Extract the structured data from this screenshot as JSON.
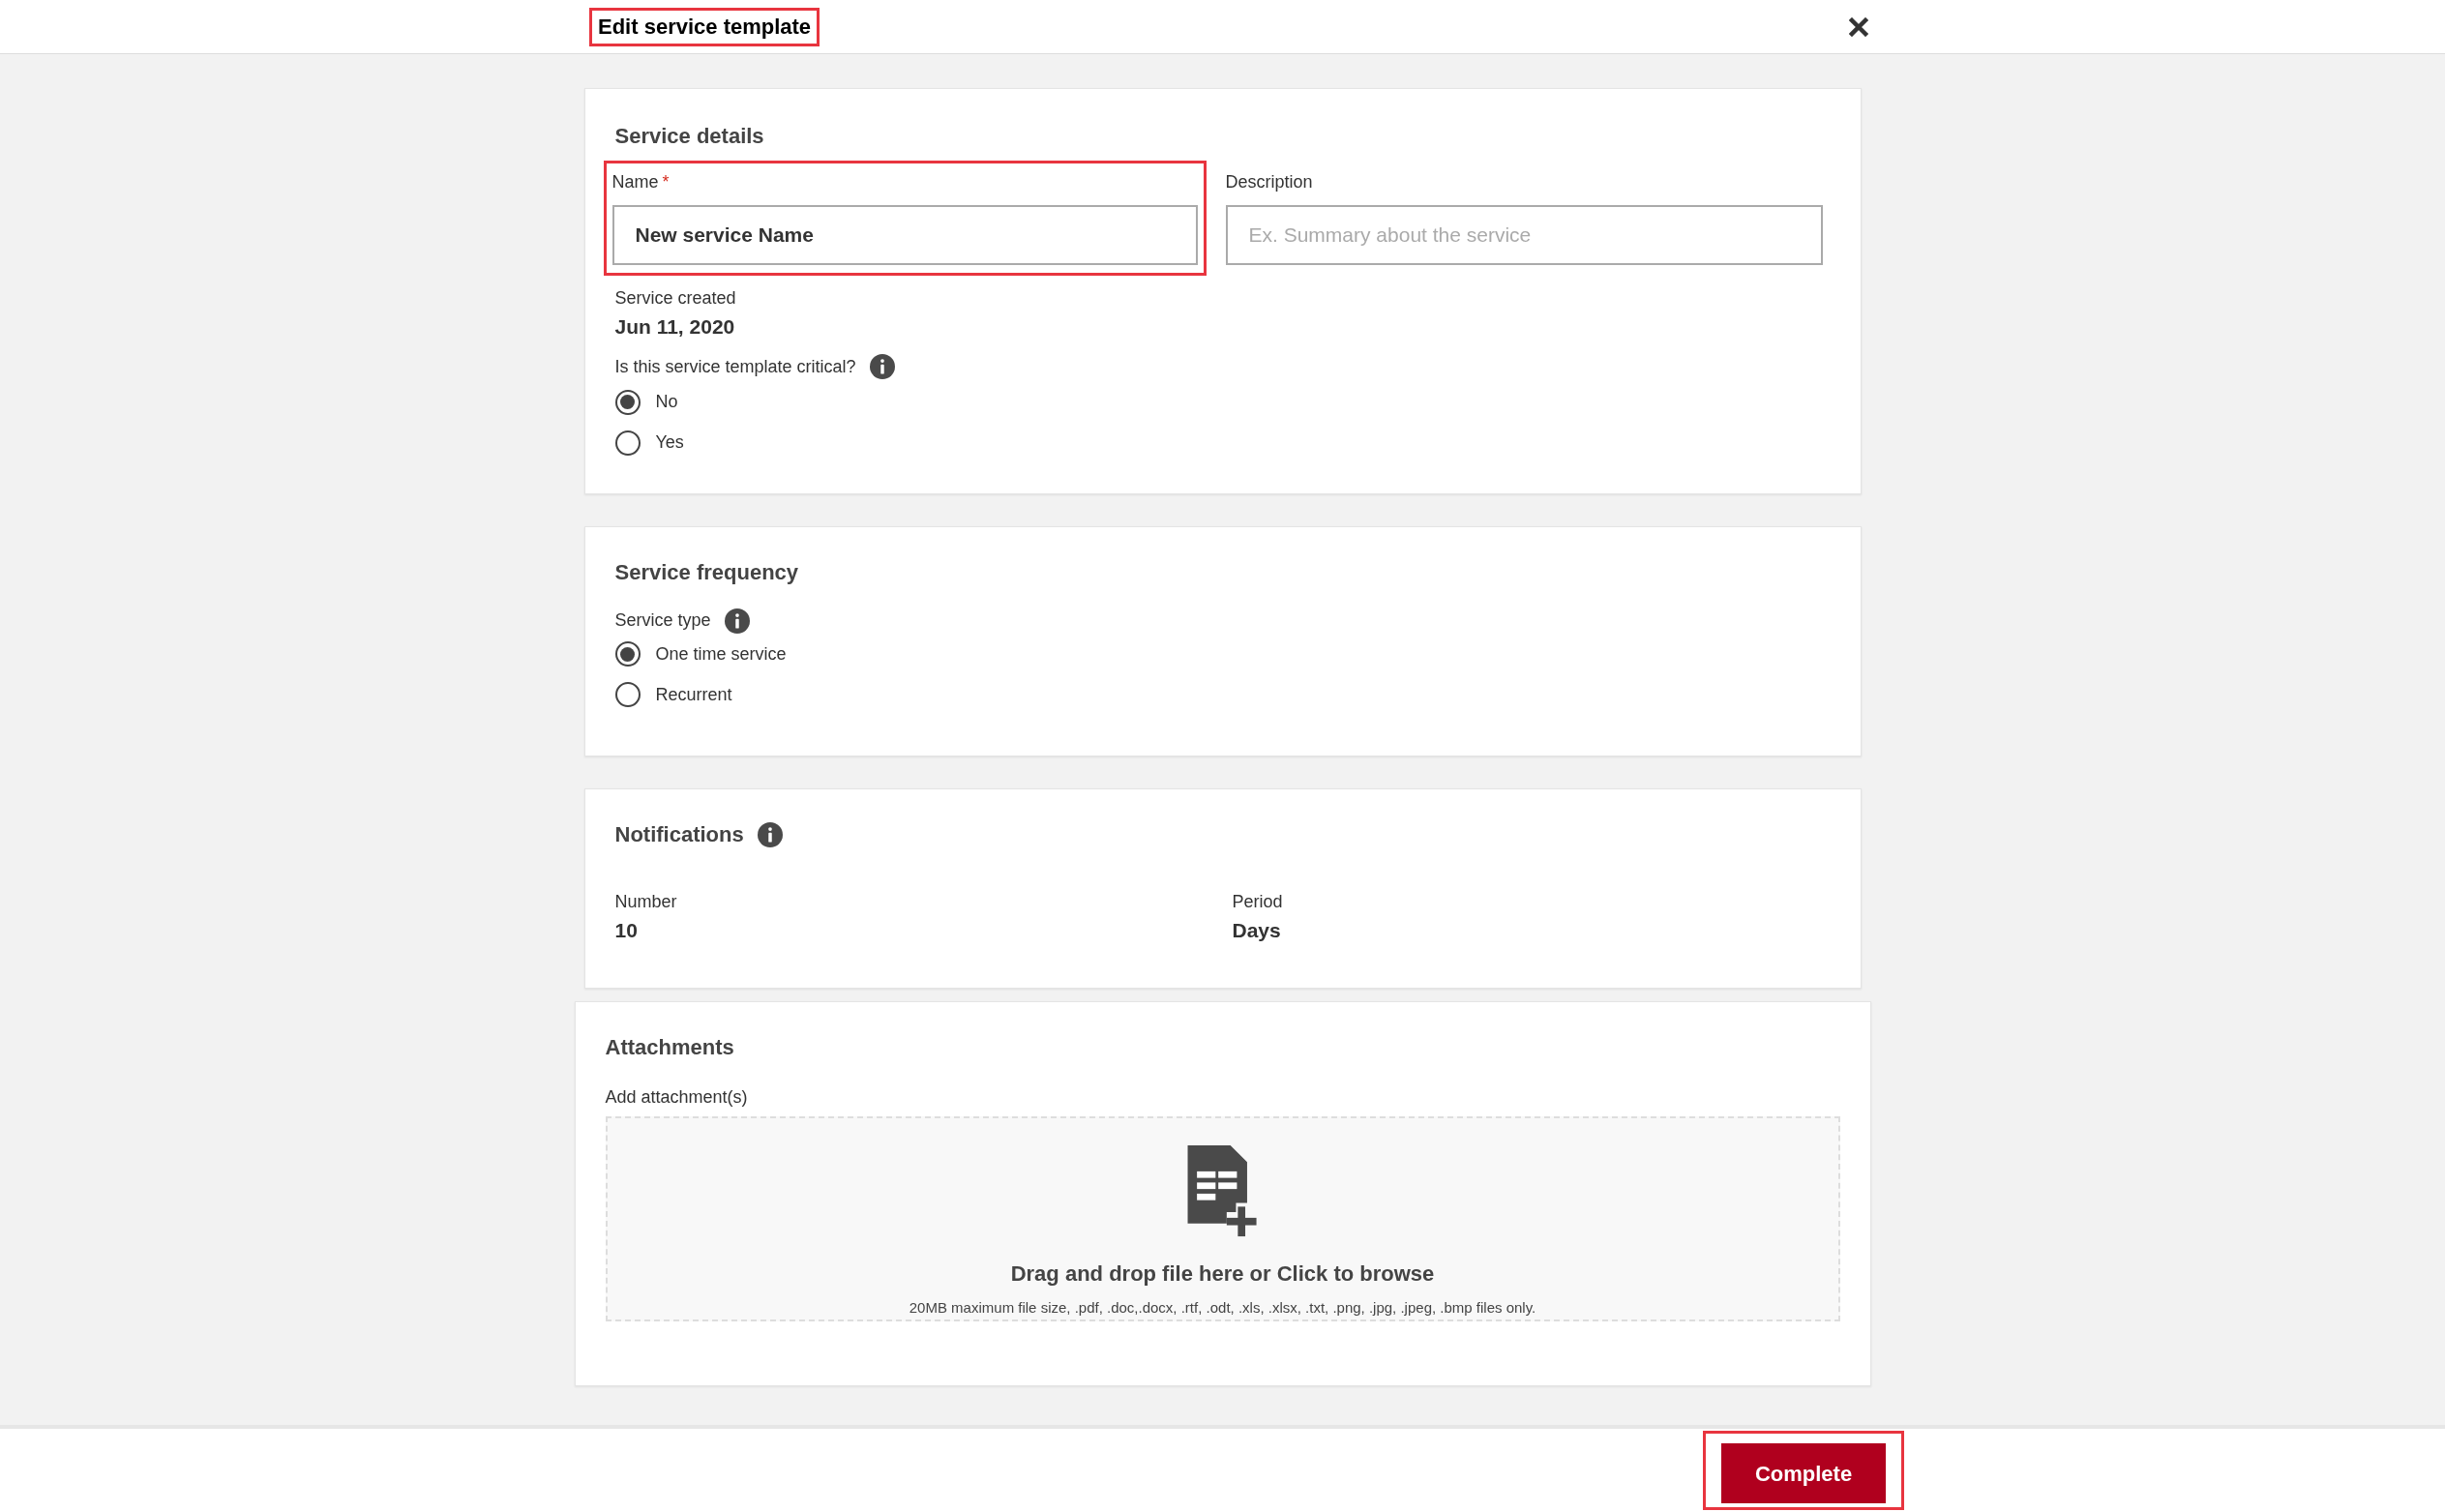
{
  "header": {
    "title": "Edit service template",
    "highlighted": true
  },
  "service_details": {
    "title": "Service details",
    "name_field": {
      "label": "Name",
      "required_mark": "*",
      "value": "New service Name",
      "highlighted": true
    },
    "description_field": {
      "label": "Description",
      "placeholder": "Ex. Summary about the service"
    },
    "created": {
      "label": "Service created",
      "value": "Jun 11, 2020"
    },
    "critical": {
      "label": "Is this service template critical?",
      "options": [
        {
          "label": "No",
          "selected": true
        },
        {
          "label": "Yes",
          "selected": false
        }
      ]
    }
  },
  "service_frequency": {
    "title": "Service frequency",
    "service_type": {
      "label": "Service type",
      "options": [
        {
          "label": "One time service",
          "selected": true
        },
        {
          "label": "Recurrent",
          "selected": false
        }
      ]
    }
  },
  "notifications": {
    "title": "Notifications",
    "fields": [
      {
        "label": "Number",
        "value": "10"
      },
      {
        "label": "Period",
        "value": "Days"
      }
    ]
  },
  "attachments": {
    "title": "Attachments",
    "label": "Add attachment(s)",
    "drop_text": "Drag and drop file here or Click to browse",
    "hint": "20MB maximum file size, .pdf, .doc,.docx, .rtf, .odt, .xls, .xlsx, .txt, .png, .jpg, .jpeg, .bmp files only."
  },
  "footer": {
    "button": "Complete",
    "highlighted": true
  }
}
